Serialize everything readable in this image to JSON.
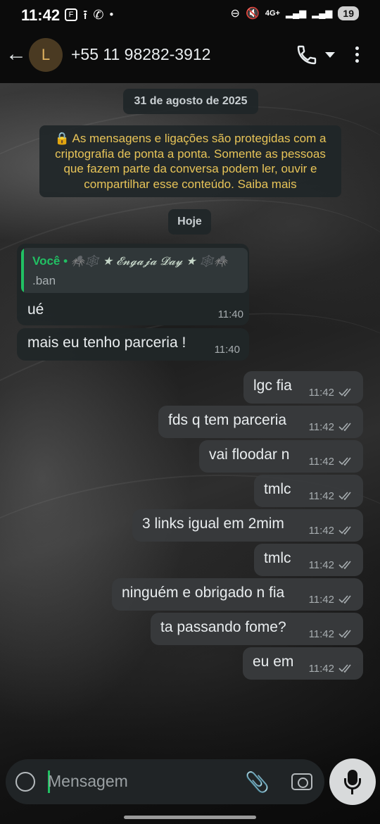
{
  "status_bar": {
    "time": "11:42",
    "network": "4G+",
    "battery": "19"
  },
  "header": {
    "avatar_letter": "L",
    "title": "+55 11 98282-3912"
  },
  "chat": {
    "date_chip": "31 de agosto de 2025",
    "encryption_notice": "🔒 As mensagens e ligações são protegidas com a criptografia de ponta a ponta. Somente as pessoas que fazem parte da conversa podem ler, ouvir e compartilhar esse conteúdo. Saiba mais",
    "today_chip": "Hoje",
    "quoted": {
      "author": "Você •",
      "author_suffix": "🕷️🕸️ ★ 𝓔𝓷𝓰𝓪𝓳𝓪 𝓓𝓪𝔂 ★ 🕸️🕷️",
      "text": ".ban"
    },
    "incoming": [
      {
        "text": "ué",
        "time": "11:40"
      },
      {
        "text": "mais eu tenho parceria !",
        "time": "11:40"
      }
    ],
    "outgoing": [
      {
        "text": "lgc fia",
        "time": "11:42"
      },
      {
        "text": "fds q tem parceria",
        "time": "11:42"
      },
      {
        "text": "vai floodar n",
        "time": "11:42"
      },
      {
        "text": "tmlc",
        "time": "11:42"
      },
      {
        "text": "3 links igual em 2mim",
        "time": "11:42"
      },
      {
        "text": "tmlc",
        "time": "11:42"
      },
      {
        "text": "ninguém e obrigado n fia",
        "time": "11:42"
      },
      {
        "text": "ta passando fome?",
        "time": "11:42"
      },
      {
        "text": "eu em",
        "time": "11:42"
      }
    ]
  },
  "composer": {
    "placeholder": "Mensagem"
  },
  "colors": {
    "accent_green": "#21c063",
    "notice_yellow": "#e8c458",
    "tick_gray": "#a7adb0"
  }
}
